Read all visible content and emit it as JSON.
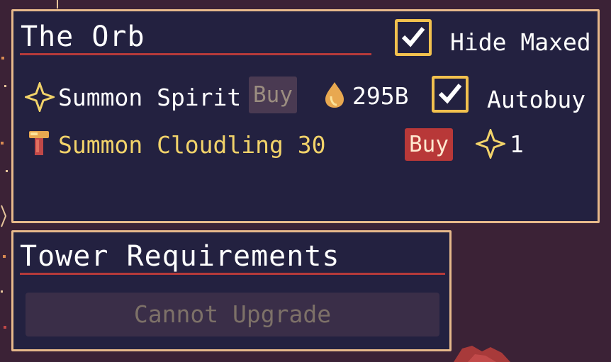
{
  "orb_panel": {
    "title": "The Orb",
    "hide_maxed": {
      "label": "Hide Maxed",
      "checked": true
    },
    "rows": [
      {
        "icon": "spirit-sparkle-icon",
        "name": "Summon Spirit",
        "buy_label": "Buy",
        "buy_enabled": false,
        "cost_icon": "essence-drop-icon",
        "cost": "295B",
        "autobuy": {
          "label": "Autobuy",
          "checked": true
        }
      },
      {
        "icon": "mushroom-icon",
        "name": "Summon Cloudling 30",
        "buy_label": "Buy",
        "buy_enabled": true,
        "cost_icon": "spirit-sparkle-icon",
        "cost": "1"
      }
    ]
  },
  "tower_panel": {
    "title": "Tower Requirements",
    "upgrade_label": "Cannot Upgrade",
    "upgrade_enabled": false
  },
  "colors": {
    "panel_bg": "#232140",
    "panel_border": "#e7b98b",
    "title_underline": "#b53a3a",
    "checkbox_border": "#f2c14e",
    "buy_active": "#b83838",
    "buy_disabled": "#4a3a52",
    "highlight_text": "#f2d36a",
    "background": "#3b2236"
  }
}
